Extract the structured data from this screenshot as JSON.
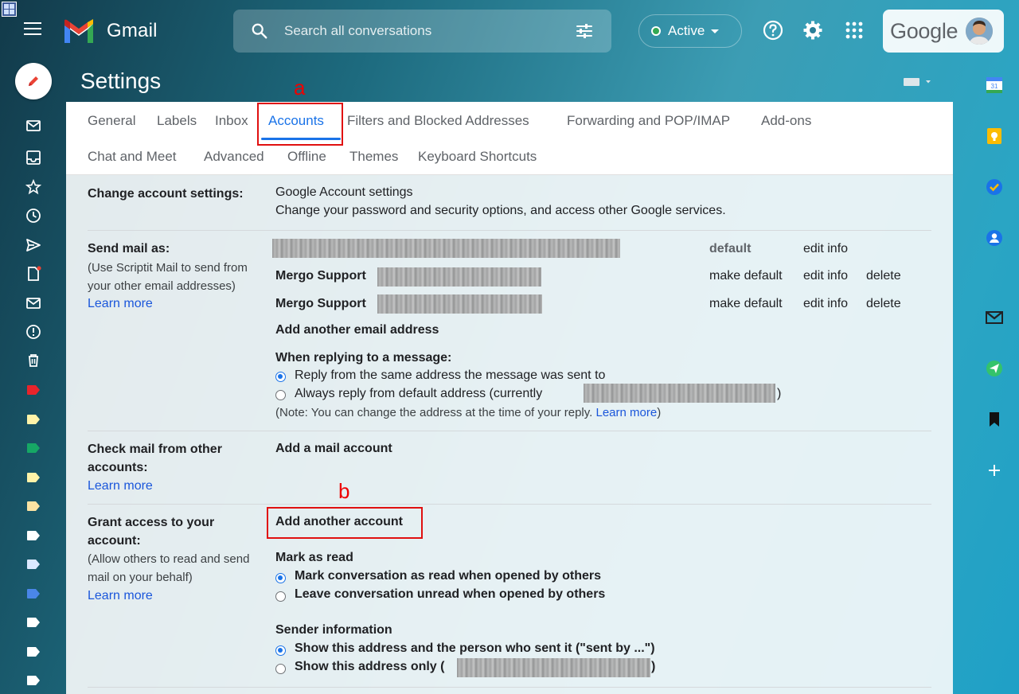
{
  "app": {
    "name": "Gmail"
  },
  "search": {
    "placeholder": "Search all conversations"
  },
  "status": {
    "label": "Active"
  },
  "account": {
    "brand": "Google"
  },
  "page": {
    "title": "Settings"
  },
  "annotations": {
    "a": "a",
    "b": "b"
  },
  "tabs_row1": [
    "General",
    "Labels",
    "Inbox",
    "Accounts",
    "Filters and Blocked Addresses",
    "Forwarding and POP/IMAP",
    "Add-ons"
  ],
  "tabs_row2": [
    "Chat and Meet",
    "Advanced",
    "Offline",
    "Themes",
    "Keyboard Shortcuts"
  ],
  "active_tab": "Accounts",
  "change_account": {
    "label": "Change account settings:",
    "link": "Google Account settings",
    "desc": "Change your password and security options, and access other Google services."
  },
  "send_mail": {
    "label": "Send mail as:",
    "sub1": "(Use Scriptit Mail to send from",
    "sub2": "your other email addresses)",
    "learn_more": "Learn more",
    "rows": [
      {
        "name": "",
        "status": "default",
        "edit": "edit info",
        "delete": ""
      },
      {
        "name": "Mergo Support",
        "status": "make default",
        "edit": "edit info",
        "delete": "delete"
      },
      {
        "name": "Mergo Support",
        "status": "make default",
        "edit": "edit info",
        "delete": "delete"
      }
    ],
    "add_link": "Add another email address",
    "reply_heading": "When replying to a message:",
    "reply_opt1": "Reply from the same address the message was sent to",
    "reply_opt2_pre": "Always reply from default address (currently",
    "reply_opt2_post": ")",
    "note_pre": "(Note: You can change the address at the time of your reply.",
    "note_link": "Learn more",
    "note_post": ")"
  },
  "check_mail": {
    "label1": "Check mail from other",
    "label2": "accounts:",
    "learn_more": "Learn more",
    "add_link": "Add a mail account"
  },
  "grant_access": {
    "label1": "Grant access to your",
    "label2": "account:",
    "sub1": "(Allow others to read and send",
    "sub2": "mail on your behalf)",
    "learn_more": "Learn more",
    "add_link": "Add another account",
    "mark_heading": "Mark as read",
    "mark_opt1": "Mark conversation as read when opened by others",
    "mark_opt2": "Leave conversation unread when opened by others",
    "sender_heading": "Sender information",
    "sender_opt1": "Show this address and the person who sent it (\"sent by ...\")",
    "sender_opt2_pre": "Show this address only (",
    "sender_opt2_post": ")"
  },
  "colors": {
    "accent": "#1a73e8",
    "link": "#1a56db",
    "annotation": "#e01010"
  }
}
